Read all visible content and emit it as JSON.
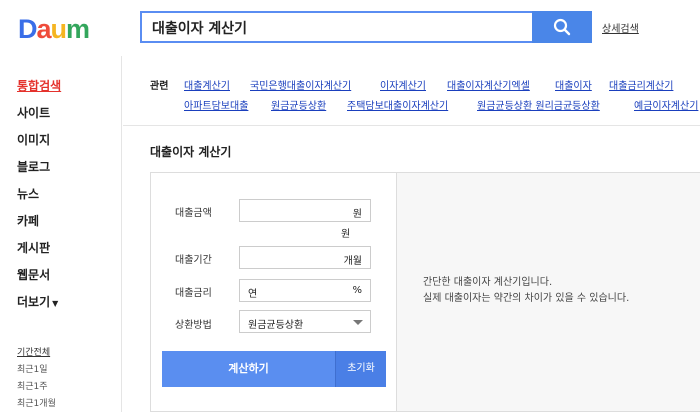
{
  "logo": {
    "letters": [
      {
        "ch": "D",
        "color": "#3a6ee8"
      },
      {
        "ch": "a",
        "color": "#ef4b3a"
      },
      {
        "ch": "u",
        "color": "#f5b521"
      },
      {
        "ch": "m",
        "color": "#33a65c"
      }
    ]
  },
  "search": {
    "query": "대출이자 계산기",
    "button_icon": "search-icon",
    "advanced_label": "상세검색"
  },
  "sidebar": {
    "items": [
      {
        "label": "통합검색",
        "active": true
      },
      {
        "label": "사이트",
        "active": false
      },
      {
        "label": "이미지",
        "active": false
      },
      {
        "label": "블로그",
        "active": false
      },
      {
        "label": "뉴스",
        "active": false
      },
      {
        "label": "카페",
        "active": false
      },
      {
        "label": "게시판",
        "active": false
      },
      {
        "label": "웹문서",
        "active": false
      },
      {
        "label": "더보기",
        "active": false
      }
    ],
    "period": {
      "header": "기간전체",
      "options": [
        "최근1일",
        "최근1주",
        "최근1개월"
      ]
    }
  },
  "related": {
    "label": "관련",
    "links": [
      "대출계산기",
      "국민은행대출이자계산기",
      "이자계산기",
      "대출이자계산기엑셀",
      "대출이자",
      "대출금리계산기",
      "아파트담보대출",
      "원금균등상환",
      "주택담보대출이자계산기",
      "원금균등상환 원리금균등상환",
      "예금이자계산기"
    ]
  },
  "calculator": {
    "title": "대출이자 계산기",
    "fields": {
      "amount": {
        "label": "대출금액",
        "unit": "원",
        "sub_unit": "원"
      },
      "period": {
        "label": "대출기간",
        "unit": "개월"
      },
      "rate": {
        "label": "대출금리",
        "prefix": "연",
        "unit": "%"
      },
      "method": {
        "label": "상환방법",
        "selected": "원금균등상환"
      }
    },
    "calc_button": "계산하기",
    "reset_button": "초기화",
    "description": [
      "간단한 대출이자 계산기입니다.",
      "실제 대출이자는 약간의 차이가 있을 수 있습니다."
    ]
  },
  "colors": {
    "accent": "#4a86e8",
    "active_nav": "#e4322d",
    "link": "#1a3fbd"
  }
}
